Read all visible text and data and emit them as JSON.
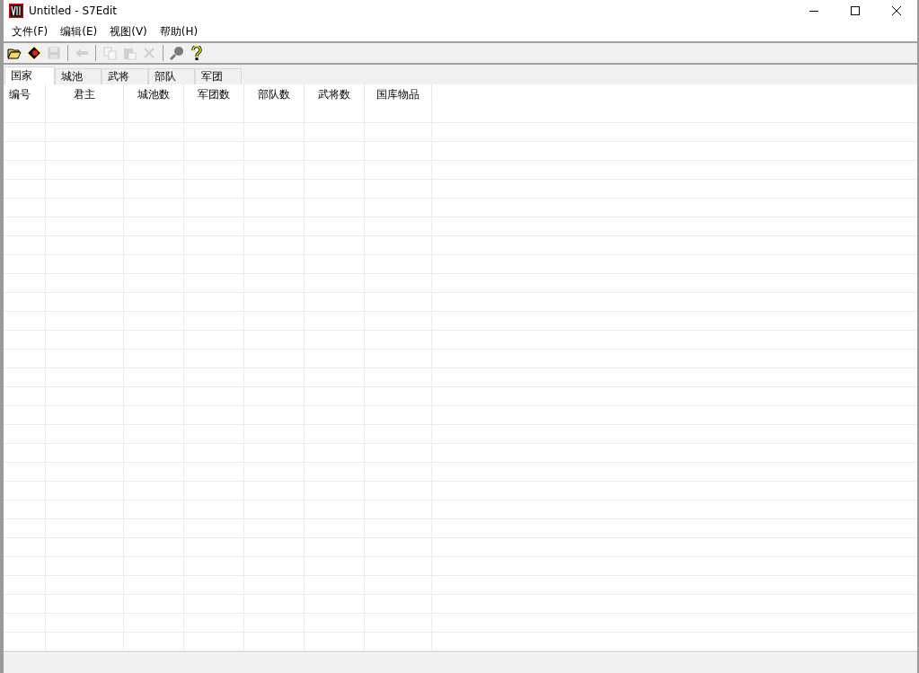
{
  "window": {
    "title": "Untitled - S7Edit"
  },
  "menu": [
    "文件(F)",
    "编辑(E)",
    "视图(V)",
    "帮助(H)"
  ],
  "toolbar": [
    {
      "kind": "open",
      "disabled": false
    },
    {
      "kind": "diamond",
      "disabled": false
    },
    {
      "kind": "save",
      "disabled": true
    },
    {
      "kind": "sep"
    },
    {
      "kind": "back",
      "disabled": true
    },
    {
      "kind": "sep"
    },
    {
      "kind": "copy",
      "disabled": true
    },
    {
      "kind": "paste",
      "disabled": true
    },
    {
      "kind": "delete",
      "disabled": true
    },
    {
      "kind": "sep"
    },
    {
      "kind": "find",
      "disabled": false
    },
    {
      "kind": "help",
      "disabled": false
    }
  ],
  "tabs": [
    {
      "label": "国家",
      "selected": true
    },
    {
      "label": "城池",
      "selected": false
    },
    {
      "label": "武将",
      "selected": false
    },
    {
      "label": "部队",
      "selected": false
    },
    {
      "label": "军团",
      "selected": false
    }
  ],
  "table": {
    "columns": [
      "编号",
      "君主",
      "城池数",
      "军团数",
      "部队数",
      "武将数",
      "国库物品"
    ]
  }
}
